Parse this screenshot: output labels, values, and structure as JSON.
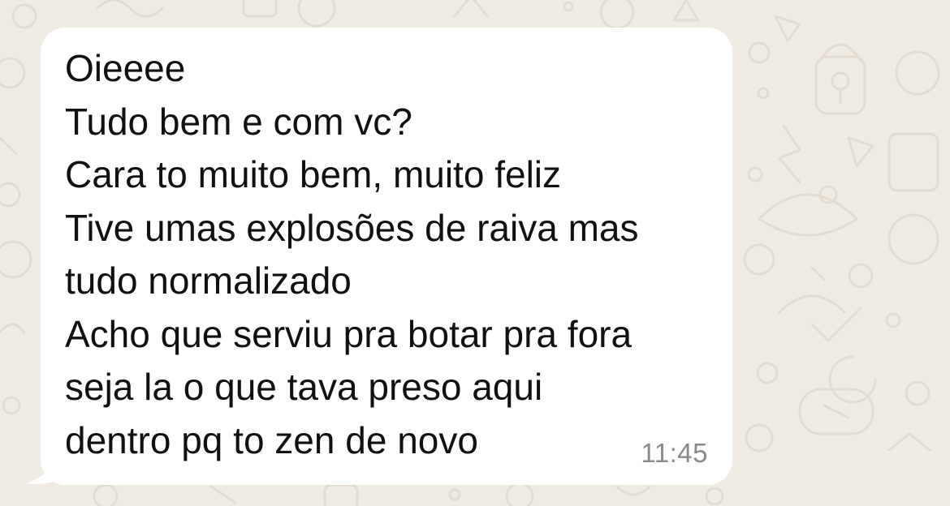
{
  "chat": {
    "background_color": "#efeae2",
    "message": {
      "direction": "incoming",
      "bubble_color": "#ffffff",
      "lines": [
        "Oieeee",
        "Tudo bem e com vc?",
        "Cara to muito bem, muito feliz",
        "Tive umas explosões de raiva mas",
        "tudo normalizado",
        "Acho que serviu pra botar pra fora",
        "seja la o que tava preso aqui",
        "dentro pq to zen de novo"
      ],
      "time": "11:45"
    }
  }
}
